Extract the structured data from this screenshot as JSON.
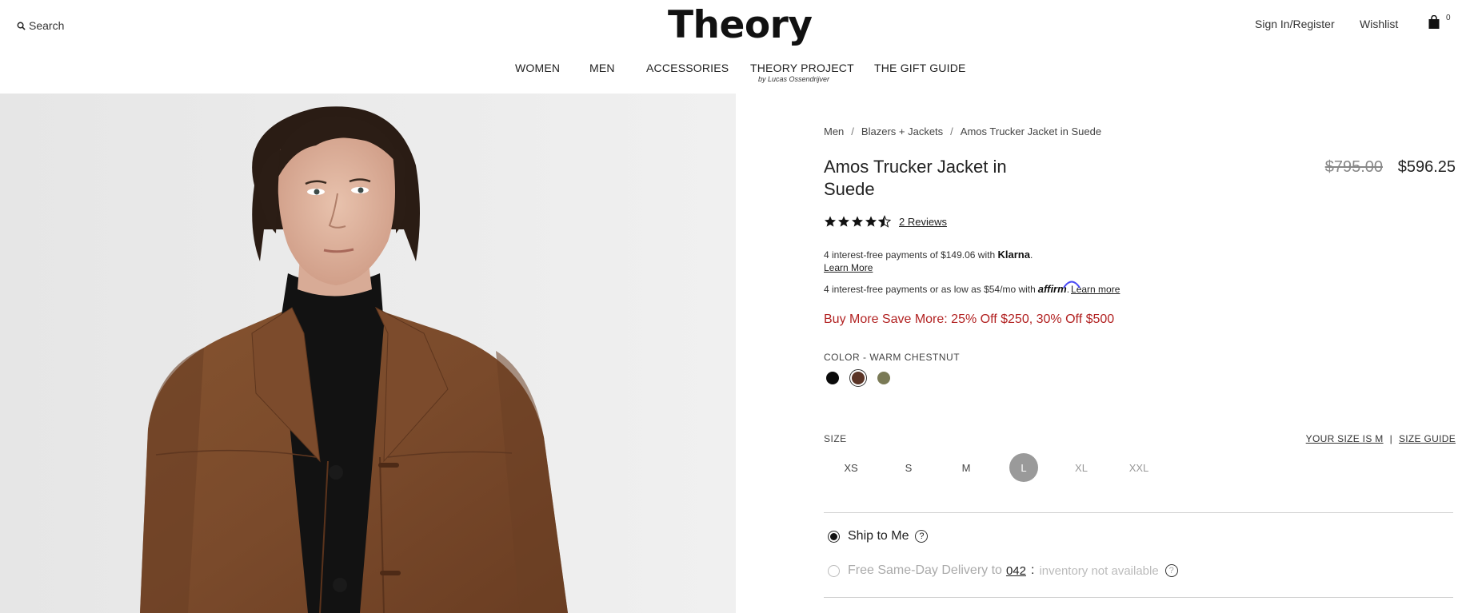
{
  "header": {
    "search_label": "Search",
    "logo": "Theory",
    "sign_in": "Sign In/Register",
    "wishlist": "Wishlist",
    "bag_count": "0"
  },
  "nav": {
    "items": [
      "WOMEN",
      "MEN",
      "ACCESSORIES",
      "THEORY PROJECT",
      "THE GIFT GUIDE"
    ],
    "theory_project_sub": "by Lucas Ossendrijver"
  },
  "breadcrumb": {
    "items": [
      "Men",
      "Blazers + Jackets",
      "Amos Trucker Jacket in Suede"
    ],
    "separator": "/"
  },
  "product": {
    "title": "Amos Trucker Jacket in Suede",
    "price_original": "$795.00",
    "price_sale": "$596.25",
    "rating": 4.5,
    "reviews_label": "2 Reviews"
  },
  "payments": {
    "klarna_text": "4 interest-free payments of $149.06 with",
    "klarna_brand": "Klarna",
    "klarna_learn": "Learn More",
    "affirm_text": "4 interest-free payments or as low as $54/mo with",
    "affirm_brand": "affirm",
    "affirm_learn": "Learn more"
  },
  "promo": "Buy More Save More: 25% Off $250, 30% Off $500",
  "color": {
    "label": "COLOR - WARM CHESTNUT",
    "swatches": [
      {
        "name": "black",
        "hex": "#0b0b0b"
      },
      {
        "name": "warm-chestnut",
        "hex": "#5a3426",
        "selected": true
      },
      {
        "name": "olive",
        "hex": "#7a7a56"
      }
    ]
  },
  "size": {
    "label": "SIZE",
    "your_size": "YOUR SIZE IS M",
    "divider": "|",
    "guide": "SIZE GUIDE",
    "options": [
      "XS",
      "S",
      "M",
      "L",
      "XL",
      "XXL"
    ],
    "selected": "L",
    "disabled": [
      "XL",
      "XXL"
    ]
  },
  "shipping": {
    "ship_to_me": "Ship to Me",
    "same_day": "Free Same-Day Delivery to",
    "zip": "042",
    "colon": ":",
    "unavailable": "inventory not available",
    "help": "?"
  },
  "colors": {
    "promo": "#b22222",
    "image_bg": "#ebebeb",
    "jacket": "#7a4a2c",
    "turtleneck": "#121212"
  }
}
